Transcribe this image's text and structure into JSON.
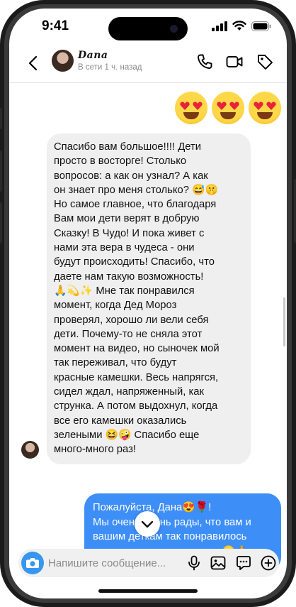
{
  "status_bar": {
    "time": "9:41"
  },
  "header": {
    "contact_name": "Dana",
    "presence": "В сети 1 ч. назад",
    "icons": [
      "back-chevron-icon",
      "phone-icon",
      "video-camera-icon",
      "tag-icon"
    ]
  },
  "messages": {
    "sent_reaction": {
      "emoji": "heart-eyes-emoji",
      "count": 3
    },
    "incoming_text": "Спасибо вам большое!!!! Дети\nпросто в восторге! Столько\nвопросов: а как он узнал? А как\nон знает про меня столько? 😅🤫\nНо самое главное, что благодаря\nВам мои дети верят в добрую\nСказку! В Чудо! И пока живет с\nнами эта вера в чудеса - они\nбудут происходить! Спасибо, что\nдаете нам такую возможность!\n🙏💫✨ Мне так понравился\nмомент, когда Дед Мороз\nпроверял, хорошо ли вели себя\nдети. Почему-то не сняла этот\nмомент на видео, но сыночек мой\nтак переживал, что будут\nкрасные камешки. Весь напрягся,\nсидел ждал, напряженный, как\nструнка. А потом выдохнул, когда\nвсе его камешки оказались\nзелеными 😆🤪 Спасибо еще\nмного-много раз!",
    "outgoing_text": "Пожалуйста, Дана😍🌹!\nМы очень очень рады, что вам и\nвашим деткам так понравилось\nнаше видеопоздравление 😊🙏"
  },
  "composer": {
    "placeholder": "Напишите сообщение...",
    "icons": [
      "camera-icon",
      "microphone-icon",
      "gallery-icon",
      "sticker-icon",
      "plus-icon"
    ]
  },
  "colors": {
    "accent": "#3797f0",
    "outgoing_bubble": "#3d8ef7",
    "incoming_bubble": "#efefef"
  }
}
